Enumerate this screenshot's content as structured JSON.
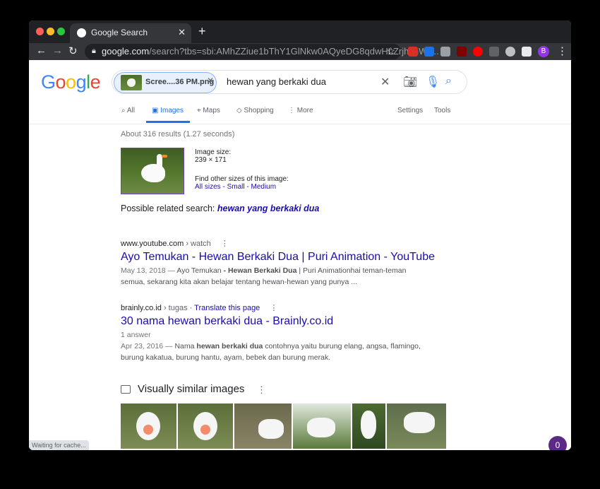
{
  "colors": {
    "accent": "#1a73e8",
    "link": "#1a0dab",
    "chrome_dark": "#202124"
  },
  "browser": {
    "tab_title": "Google Search",
    "url_host": "google.com",
    "url_rest": "/search?tbs=sbi:AMhZZiue1bThY1GlNkw0AQyeDG8qdwHLZrjhchWv...",
    "avatar_letter": "B"
  },
  "search": {
    "chip_label": "Scree....36 PM.png",
    "query": "hewan yang berkaki dua"
  },
  "tabs": [
    {
      "label": "All",
      "icon": "search-icon"
    },
    {
      "label": "Images",
      "icon": "image-icon"
    },
    {
      "label": "Maps",
      "icon": "map-pin-icon"
    },
    {
      "label": "Shopping",
      "icon": "tag-icon"
    },
    {
      "label": "More",
      "icon": "kebab-icon"
    }
  ],
  "tools": {
    "settings": "Settings",
    "tools": "Tools"
  },
  "stats": "About 316 results (1.27 seconds)",
  "image_info": {
    "size_label": "Image size:",
    "size_value": "239 × 171",
    "find_label": "Find other sizes of this image:",
    "all_sizes": "All sizes",
    "small": "Small",
    "medium": "Medium",
    "sep": " - "
  },
  "related": {
    "prefix": "Possible related search:",
    "query": "hewan yang berkaki dua"
  },
  "results": [
    {
      "site": "www.youtube.com",
      "path": " › watch",
      "title": "Ayo Temukan - Hewan Berkaki Dua | Puri Animation - YouTube",
      "date": "May 13, 2018 — ",
      "snippet_a": "Ayo Temukan ",
      "snippet_b": "- Hewan Berkaki Dua",
      "snippet_c": " | Puri Animationhai teman-teman semua, sekarang kita akan belajar tentang hewan-hewan yang punya ..."
    },
    {
      "site": "brainly.co.id",
      "path": " › tugas",
      "translate": "Translate this page",
      "title": "30 nama hewan berkaki dua - Brainly.co.id",
      "answers": "1 answer",
      "date": "Apr 23, 2016 — ",
      "snippet_a": "Nama ",
      "snippet_b": "hewan berkaki dua",
      "snippet_c": " contohnya yaitu burung elang, angsa, flamingo, burung kakatua, burung hantu, ayam, bebek dan burung merak."
    }
  ],
  "similar_title": "Visually similar images",
  "fab_count": "0",
  "status_text": "Waiting for cache..."
}
